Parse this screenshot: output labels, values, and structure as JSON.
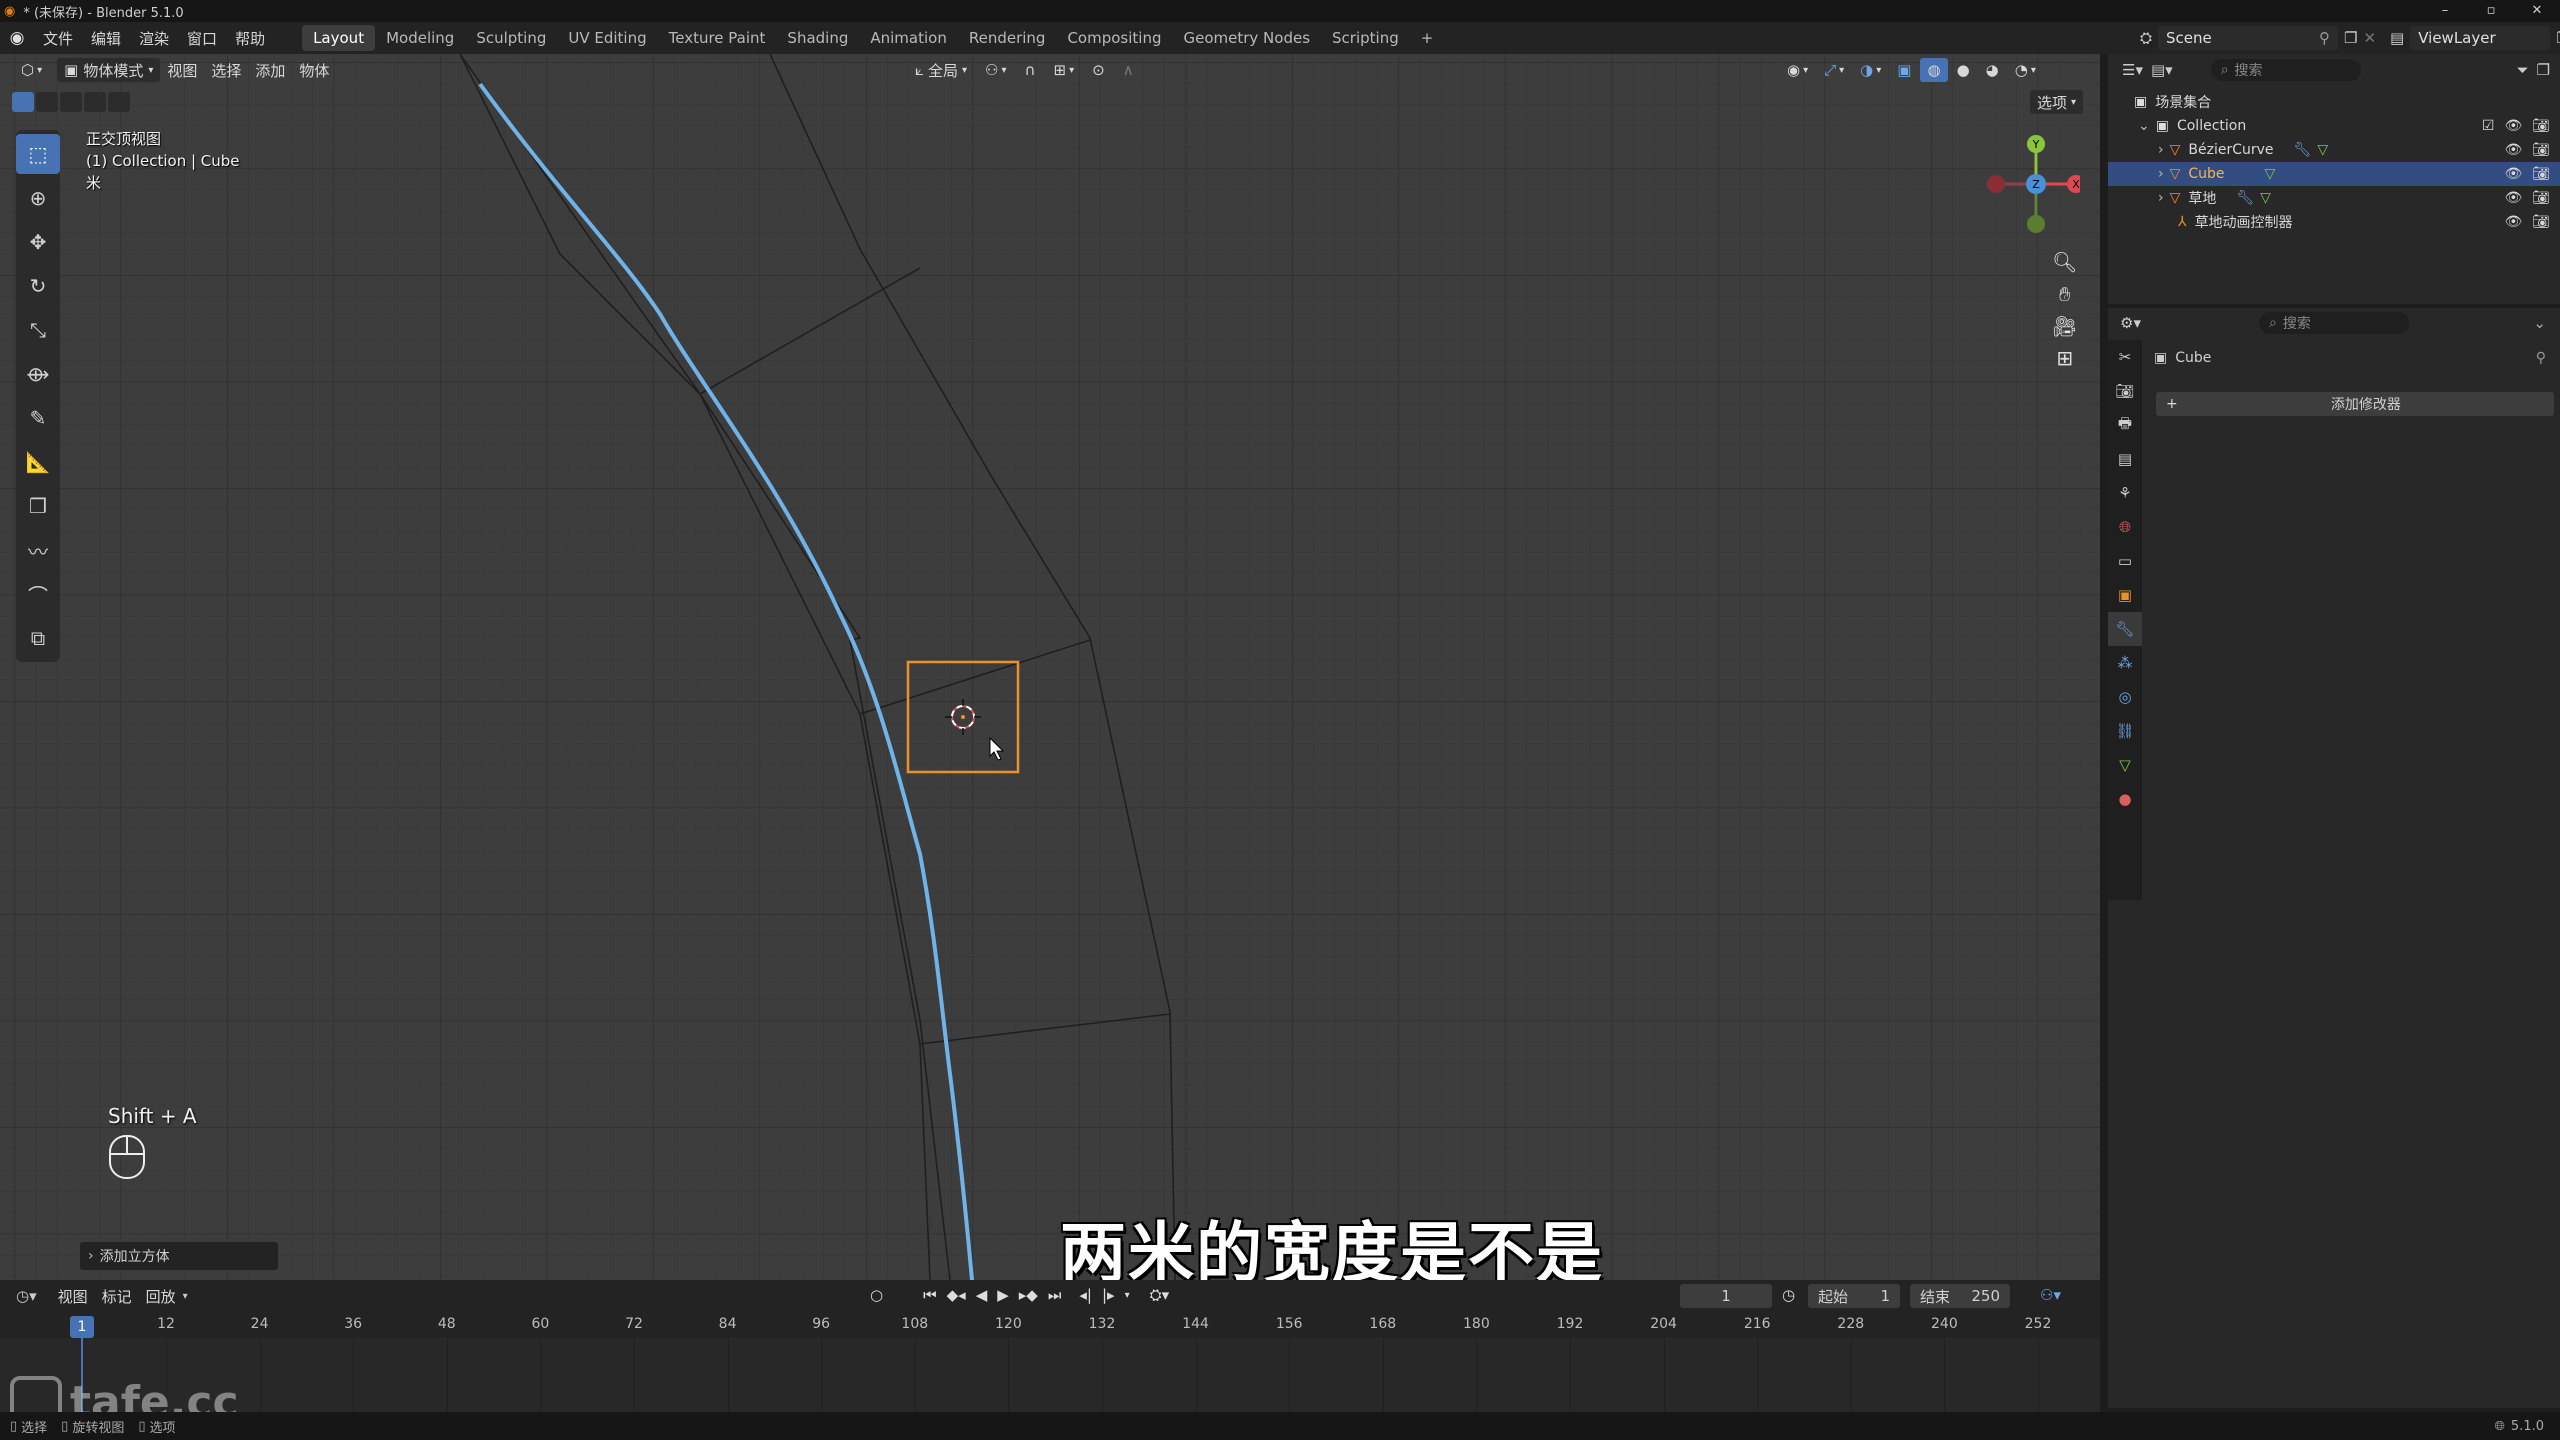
{
  "window": {
    "title": "* (未保存) - Blender 5.1.0",
    "controls": [
      "–",
      "▫",
      "✕"
    ]
  },
  "menubar": {
    "menus": [
      "文件",
      "编辑",
      "渲染",
      "窗口",
      "帮助"
    ],
    "workspaces": [
      "Layout",
      "Modeling",
      "Sculpting",
      "UV Editing",
      "Texture Paint",
      "Shading",
      "Animation",
      "Rendering",
      "Compositing",
      "Geometry Nodes",
      "Scripting"
    ],
    "active_workspace": "Layout",
    "add_tab": "+",
    "scene": "Scene",
    "view_layer": "ViewLayer"
  },
  "viewport": {
    "mode": "物体模式",
    "menus": [
      "视图",
      "选择",
      "添加",
      "物体"
    ],
    "transform_orientation": "全局",
    "options_label": "选项",
    "view_name": "正交顶视图",
    "collection_info": "(1) Collection | Cube",
    "unit": "米",
    "shortcut_hint": "Shift + A",
    "last_operator": "添加立方体",
    "subtitle": "两米的宽度是不是",
    "watermark": "tafe.cc",
    "gizmo": {
      "x": "X",
      "y": "Y",
      "z": "Z"
    }
  },
  "outliner": {
    "search_placeholder": "搜索",
    "root": "场景集合",
    "collection": "Collection",
    "items": [
      {
        "name": "BézierCurve",
        "selected": false
      },
      {
        "name": "Cube",
        "selected": true
      },
      {
        "name": "草地",
        "selected": false
      },
      {
        "name": "草地动画控制器",
        "selected": false
      }
    ]
  },
  "properties": {
    "search_placeholder": "搜索",
    "object_name": "Cube",
    "add_modifier": "添加修改器"
  },
  "timeline": {
    "menus": [
      "视图",
      "标记",
      "回放"
    ],
    "current_frame": "1",
    "start_label": "起始",
    "start_value": "1",
    "end_label": "结束",
    "end_value": "250",
    "ticks": [
      "12",
      "24",
      "36",
      "48",
      "60",
      "72",
      "84",
      "96",
      "108",
      "120",
      "132",
      "144",
      "156",
      "168",
      "180",
      "192",
      "204",
      "216",
      "228",
      "240",
      "252"
    ],
    "playhead_label": "1"
  },
  "status": {
    "items": [
      "选择",
      "旋转视图",
      "选项"
    ],
    "version": "5.1.0"
  },
  "colors": {
    "accent": "#4772b3",
    "selection_orange": "#e8912d",
    "curve_blue": "#6fb3e8",
    "selected_row": "#334d80"
  }
}
